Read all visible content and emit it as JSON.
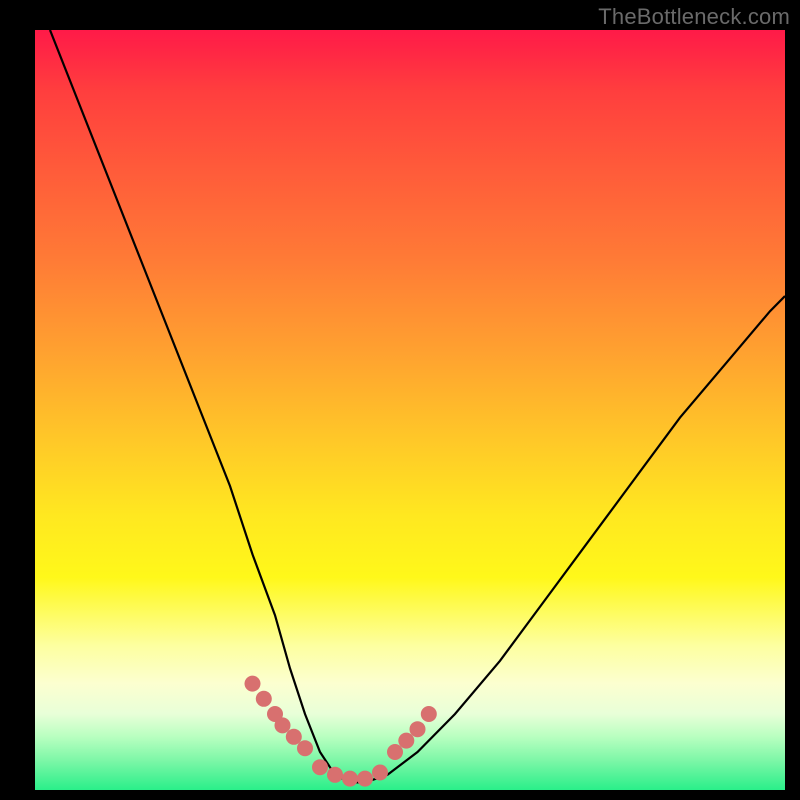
{
  "watermark": "TheBottleneck.com",
  "chart_data": {
    "type": "line",
    "title": "",
    "xlabel": "",
    "ylabel": "",
    "xlim": [
      0,
      100
    ],
    "ylim": [
      0,
      100
    ],
    "series": [
      {
        "name": "bottleneck-curve",
        "x": [
          2,
          6,
          10,
          14,
          18,
          22,
          26,
          29,
          32,
          34,
          36,
          38,
          40,
          42,
          44,
          47,
          51,
          56,
          62,
          68,
          74,
          80,
          86,
          92,
          98,
          100
        ],
        "y": [
          100,
          90,
          80,
          70,
          60,
          50,
          40,
          31,
          23,
          16,
          10,
          5,
          2,
          1,
          1,
          2,
          5,
          10,
          17,
          25,
          33,
          41,
          49,
          56,
          63,
          65
        ]
      }
    ],
    "annotations": [
      {
        "name": "marker-cluster-left",
        "x": [
          29,
          30.5,
          32,
          33,
          34.5,
          36
        ],
        "y": [
          14,
          12,
          10,
          8.5,
          7,
          5.5
        ]
      },
      {
        "name": "marker-cluster-right",
        "x": [
          48,
          49.5,
          51,
          52.5
        ],
        "y": [
          5,
          6.5,
          8,
          10
        ]
      },
      {
        "name": "marker-cluster-bottom",
        "x": [
          38,
          40,
          42,
          44,
          46
        ],
        "y": [
          3,
          2,
          1.5,
          1.5,
          2.3
        ]
      }
    ],
    "marker_color": "#d8706f",
    "curve_color": "#000000"
  }
}
